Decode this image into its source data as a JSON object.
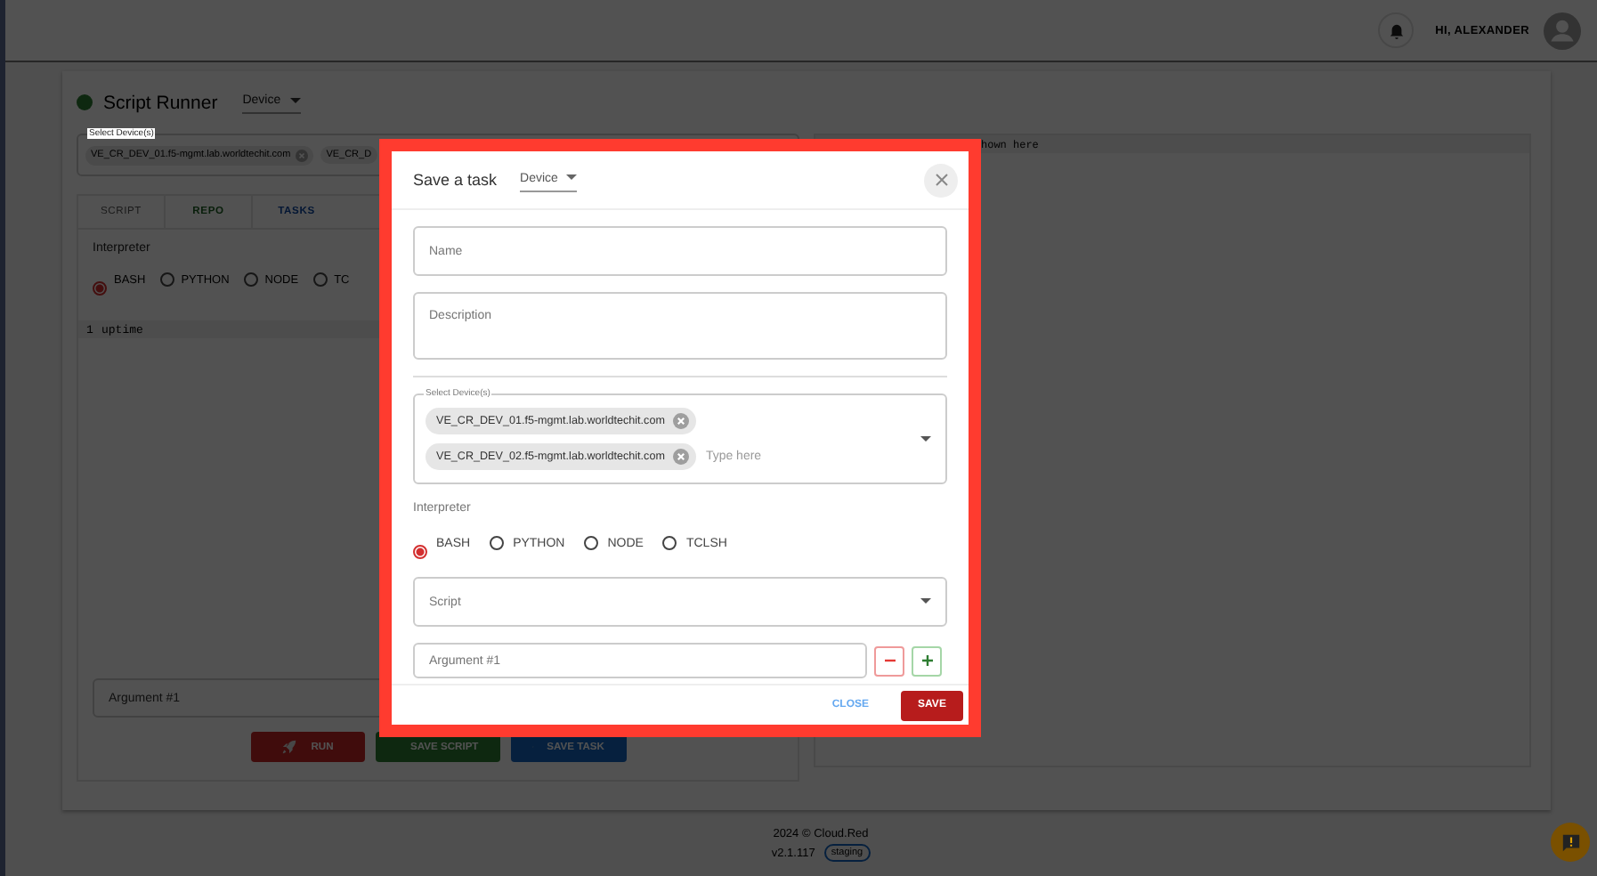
{
  "header": {
    "greeting": "HI, ALEXANDER"
  },
  "runner": {
    "online": true,
    "title": "Script Runner",
    "mode": "Device",
    "devices": {
      "label": "Select Device(s)",
      "chips": [
        "VE_CR_DEV_01.f5-mgmt.lab.worldtechit.com",
        "VE_CR_D"
      ]
    },
    "tabs": [
      {
        "label": "SCRIPT",
        "disabled": true
      },
      {
        "label": "REPO",
        "disabled": false
      },
      {
        "label": "TASKS",
        "disabled": false
      }
    ],
    "interpreter": {
      "label": "Interpreter",
      "options": [
        {
          "label": "BASH",
          "selected": true
        },
        {
          "label": "PYTHON",
          "selected": false
        },
        {
          "label": "NODE",
          "selected": false
        },
        {
          "label": "TC",
          "selected": false
        }
      ]
    },
    "editor": {
      "lines": [
        {
          "number": "1",
          "code": "uptime"
        }
      ]
    },
    "argument": {
      "placeholder": "Argument #1"
    },
    "actions": [
      {
        "label": "RUN",
        "kind": "run"
      },
      {
        "label": "SAVE SCRIPT",
        "kind": "save-script"
      },
      {
        "label": "SAVE TASK",
        "kind": "save-task"
      }
    ],
    "output": {
      "header": "hown here"
    }
  },
  "footer": {
    "copyright": "2024 © Cloud.Red",
    "version": "v2.1.117",
    "environment": "staging"
  },
  "dialog": {
    "title": "Save a task",
    "mode": "Device",
    "name": {
      "placeholder": "Name"
    },
    "description": {
      "placeholder": "Description"
    },
    "devices": {
      "label": "Select Device(s)",
      "chips": [
        "VE_CR_DEV_01.f5-mgmt.lab.worldtechit.com",
        "VE_CR_DEV_02.f5-mgmt.lab.worldtechit.com"
      ],
      "placeholder": "Type here"
    },
    "interpreter": {
      "label": "Interpreter",
      "options": [
        {
          "label": "BASH",
          "selected": true
        },
        {
          "label": "PYTHON",
          "selected": false
        },
        {
          "label": "NODE",
          "selected": false
        },
        {
          "label": "TCLSH",
          "selected": false
        }
      ]
    },
    "script": {
      "placeholder": "Script"
    },
    "argument": {
      "placeholder": "Argument #1"
    },
    "buttons": [
      {
        "label": "CLOSE",
        "kind": "text"
      },
      {
        "label": "SAVE",
        "kind": "primary"
      }
    ]
  }
}
